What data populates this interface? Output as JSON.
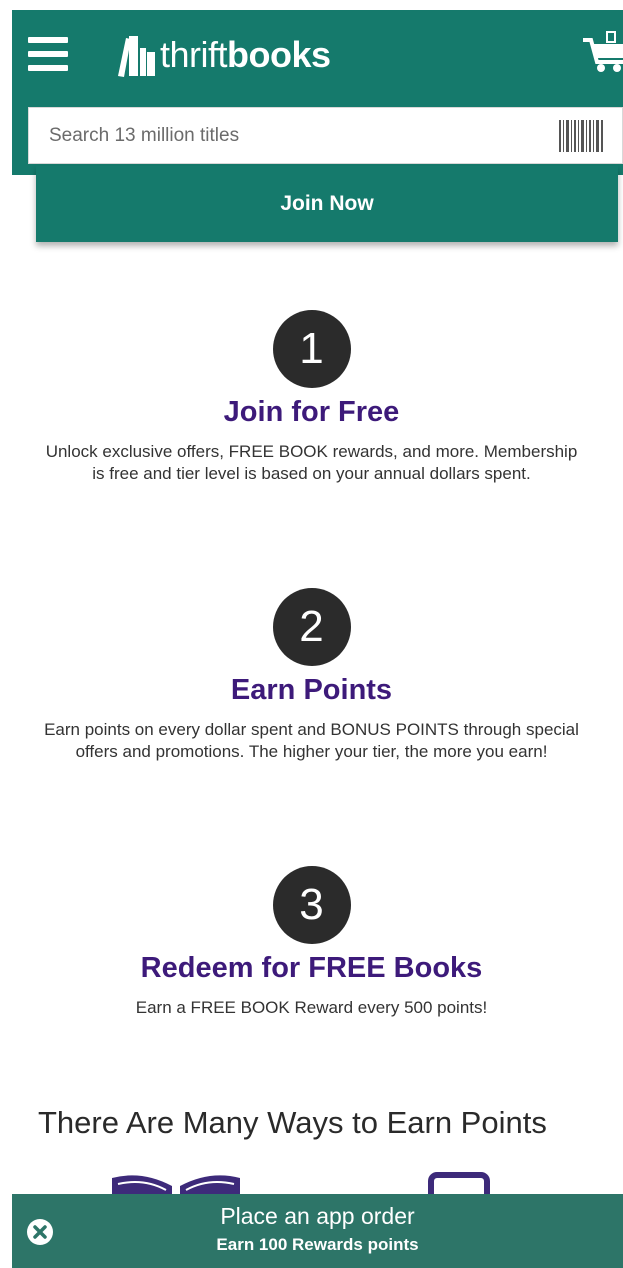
{
  "header": {
    "logo_text_light": "thrift",
    "logo_text_bold": "books",
    "menu_icon": "hamburger-menu-icon",
    "cart_icon": "cart-icon"
  },
  "search": {
    "placeholder": "Search 13 million titles",
    "value": "",
    "scanner_icon": "barcode-icon"
  },
  "join_button": {
    "label": "Join Now"
  },
  "steps": [
    {
      "number": "1",
      "title": "Join for Free",
      "description": "Unlock exclusive offers, FREE BOOK rewards, and more. Membership is free and tier level is based on your annual dollars spent."
    },
    {
      "number": "2",
      "title": "Earn Points",
      "description": "Earn points on every dollar spent and BONUS POINTS through special offers and promotions. The higher your tier, the more you earn!"
    },
    {
      "number": "3",
      "title": "Redeem for FREE Books",
      "description": "Earn a FREE BOOK Reward every 500 points!"
    }
  ],
  "ways": {
    "heading": "There Are Many Ways to Earn Points",
    "icons": [
      "open-book-icon",
      "tablet-icon"
    ]
  },
  "app_banner": {
    "title": "Place an app order",
    "subtitle": "Earn 100 Rewards points",
    "close_icon": "close-icon"
  },
  "colors": {
    "brand_green": "#157a6c",
    "banner_green": "#2d7568",
    "title_purple": "#3d1a7a",
    "step_circle": "#2b2b2b"
  }
}
